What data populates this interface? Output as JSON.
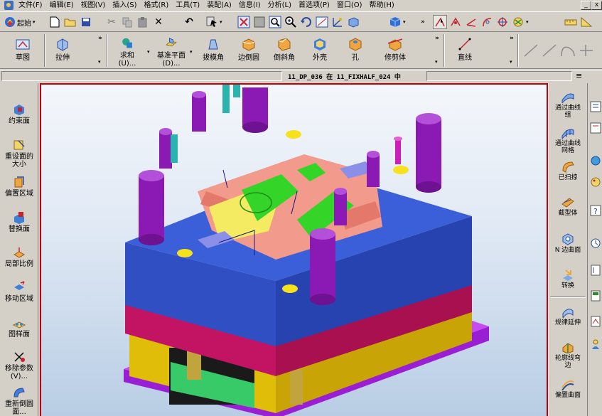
{
  "menubar": {
    "items": [
      "文件(F)",
      "编辑(E)",
      "视图(V)",
      "插入(S)",
      "格式(R)",
      "工具(T)",
      "装配(A)",
      "信息(I)",
      "分析(L)",
      "首选项(P)",
      "窗口(O)",
      "帮助(H)"
    ],
    "window_buttons": [
      "_",
      "x"
    ]
  },
  "toolbar1": {
    "start_label": "起始"
  },
  "toolbar2": {
    "sketch": "草图",
    "extrude": "拉伸",
    "sum_label_1": "求和",
    "sum_label_2": "(U)...",
    "datum_label_1": "基准平面",
    "datum_label_2": "(D)...",
    "draft": "拔模角",
    "edge_blend": "边倒圆",
    "chamfer": "倒斜角",
    "shell": "外壳",
    "hole": "孔",
    "trim_body": "修剪体",
    "line": "直线"
  },
  "selection_bar": {
    "status": "11_DP_036 在 11_FIXHALF_024 中"
  },
  "left_toolbar": {
    "items": [
      {
        "l1": "约束面",
        "l2": ""
      },
      {
        "l1": "重设面的",
        "l2": "大小"
      },
      {
        "l1": "偏置区域",
        "l2": ""
      },
      {
        "l1": "替换面",
        "l2": ""
      },
      {
        "l1": "局部比例",
        "l2": ""
      },
      {
        "l1": "移动区域",
        "l2": ""
      },
      {
        "l1": "图样面",
        "l2": ""
      },
      {
        "l1": "移除参数",
        "l2": "(V)..."
      },
      {
        "l1": "重新倒圆",
        "l2": "面..."
      }
    ]
  },
  "right_toolbar": {
    "items": [
      {
        "l1": "通过曲线",
        "l2": "组"
      },
      {
        "l1": "通过曲线",
        "l2": "网格"
      },
      {
        "l1": "已扫掠",
        "l2": ""
      },
      {
        "l1": "截型体",
        "l2": ""
      },
      {
        "l1": "N 边曲面",
        "l2": ""
      },
      {
        "l1": "转换",
        "l2": ""
      },
      {
        "l1": "规律延伸",
        "l2": ""
      },
      {
        "l1": "轮廓线弯",
        "l2": "边"
      },
      {
        "l1": "偏置曲面",
        "l2": ""
      }
    ]
  },
  "colors": {
    "viewport_border": "#c0000c",
    "mold_top": "#3a5fd9",
    "mold_side": "#2f4fc2",
    "magenta_plate": "#c21463",
    "yellow_plate": "#e0bd08",
    "purple_pin": "#8a1ab3",
    "green_insert": "#35d429",
    "pink_core": "#f29a8c"
  }
}
